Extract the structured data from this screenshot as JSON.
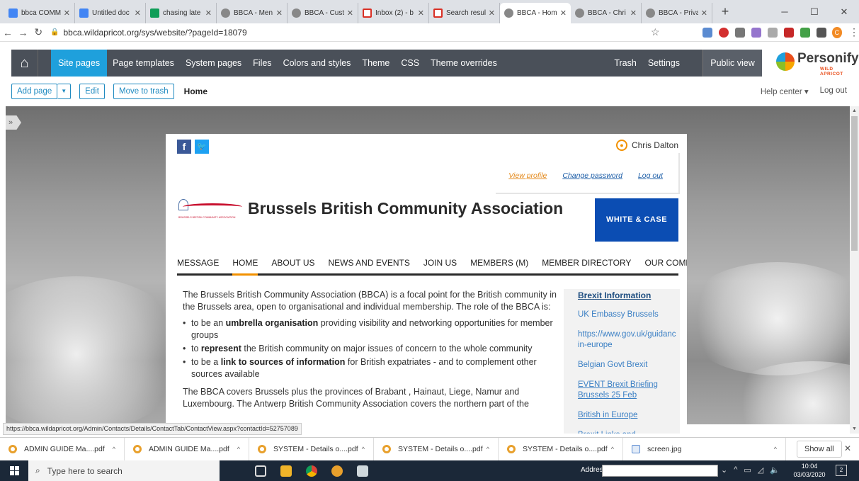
{
  "browser": {
    "tabs": [
      {
        "label": "bbca COMM",
        "icon": "docs"
      },
      {
        "label": "Untitled doc",
        "icon": "docs"
      },
      {
        "label": "chasing late",
        "icon": "sheets"
      },
      {
        "label": "BBCA - Men",
        "icon": "globe"
      },
      {
        "label": "BBCA - Cust",
        "icon": "globe"
      },
      {
        "label": "Inbox (2) - b",
        "icon": "gmail"
      },
      {
        "label": "Search resul",
        "icon": "gmail"
      },
      {
        "label": "BBCA - Hom",
        "icon": "globe",
        "active": true
      },
      {
        "label": "BBCA - Chri",
        "icon": "globe"
      },
      {
        "label": "BBCA - Priva",
        "icon": "globe"
      }
    ],
    "new_tab": "+",
    "url": "bbca.wildapricot.org/sys/website/?pageId=18079",
    "profile_initial": "C"
  },
  "admin": {
    "menu": [
      "Site pages",
      "Page templates",
      "System pages",
      "Files",
      "Colors and styles",
      "Theme",
      "CSS",
      "Theme overrides"
    ],
    "active_menu": "Site pages",
    "right_menu": [
      "Trash",
      "Settings"
    ],
    "public_view": "Public view",
    "brand_name": "Personify",
    "brand_sub": "WILD APRICOT",
    "toolbar": {
      "add_page": "Add page",
      "edit": "Edit",
      "move_to_trash": "Move to trash",
      "current_page": "Home",
      "help_center": "Help center ▾",
      "log_out": "Log out"
    }
  },
  "site": {
    "member_name": "Chris Dalton",
    "login_links": {
      "view_profile": "View profile",
      "change_password": "Change password",
      "log_out": "Log out"
    },
    "title": "Brussels British Community Association",
    "logo_caption": "BRUSSELS BRITISH COMMUNITY ASSOCIATION",
    "sponsor": "WHITE & CASE",
    "nav": [
      "MESSAGE",
      "HOME",
      "ABOUT US",
      "NEWS AND EVENTS",
      "JOIN US",
      "MEMBERS (M)",
      "MEMBER DIRECTORY",
      "OUR COMMUNITY"
    ],
    "current_nav": "HOME",
    "intro": "The Brussels British Community Association (BBCA) is a focal point for the British community in the Brussels area, open to organisational and individual membership.  The role of the BBCA is:",
    "bullets": [
      {
        "pre": "to be an ",
        "bold": "umbrella organisation",
        "post": " providing visibility and networking opportunities for member groups"
      },
      {
        "pre": "to ",
        "bold": "represent",
        "post": " the British community on major issues of concern to the whole community"
      },
      {
        "pre": "to be a ",
        "bold": "link to sources of information",
        "post": " for British expatriates - and to complement other sources available"
      }
    ],
    "outro": "The BBCA covers Brussels plus the provinces of Brabant , Hainaut, Liege, Namur and Luxembourg. The Antwerp British Community Association covers the northern part of the",
    "sidebar": {
      "heading": "Brexit Information",
      "links": [
        {
          "label": "UK Embassy Brussels",
          "underline": false
        },
        {
          "label": "https://www.gov.uk/guidance/living-in-europe",
          "display": "https://www.gov.uk/guidanc in-europe",
          "underline": false
        },
        {
          "label": "Belgian Govt Brexit",
          "underline": false
        },
        {
          "label": "EVENT Brexit Briefing Brussels 25 Feb",
          "underline": true
        },
        {
          "label": "British in Europe ",
          "underline": true
        },
        {
          "label": "Brexit Links and",
          "underline": false
        }
      ]
    }
  },
  "status_url": "https://bbca.wildapricot.org/Admin/Contacts/Details/ContactTab/ContactView.aspx?contactId=52757089",
  "downloads": [
    {
      "name": "ADMIN GUIDE Ma....pdf"
    },
    {
      "name": "ADMIN GUIDE Ma....pdf"
    },
    {
      "name": "SYSTEM - Details o....pdf"
    },
    {
      "name": "SYSTEM - Details o....pdf"
    },
    {
      "name": "SYSTEM - Details o....pdf"
    },
    {
      "name": "screen.jpg"
    }
  ],
  "show_all": "Show all",
  "taskbar": {
    "search_placeholder": "Type here to search",
    "address_label": "Address",
    "time": "10:04",
    "date": "03/03/2020",
    "notifications": "2"
  }
}
